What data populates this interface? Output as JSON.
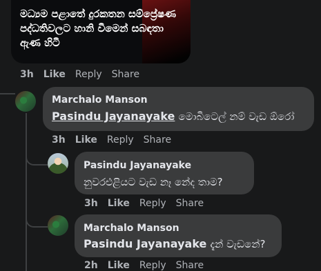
{
  "post": {
    "image_text": "මධ්‍යම පළාතේ දුරකතන සම්ප්‍රේෂණ පද්ධතිවලට හානි වීමෙන් සබඳතා ඇණ හිටී"
  },
  "post_actions": {
    "time": "3h",
    "like": "Like",
    "reply": "Reply",
    "share": "Share"
  },
  "comments": [
    {
      "author": "Marchalo Manson",
      "mention": "Pasindu Jayanayake",
      "text": "මොබිටෙල් නම් වැඩ ඕරෝ",
      "actions": {
        "time": "3h",
        "like": "Like",
        "reply": "Reply",
        "share": "Share"
      }
    },
    {
      "author": "Pasindu Jayanayake",
      "text": "නුවරඑළියට වැඩ නෑ නේද තාම?",
      "actions": {
        "time": "3h",
        "like": "Like",
        "reply": "Reply",
        "share": "Share"
      }
    },
    {
      "author": "Marchalo Manson",
      "mention": "Pasindu Jayanayake",
      "text": "දැන් වැඩනේ?",
      "actions": {
        "time": "2h",
        "like": "Like",
        "reply": "Reply",
        "share": "Share"
      }
    }
  ]
}
